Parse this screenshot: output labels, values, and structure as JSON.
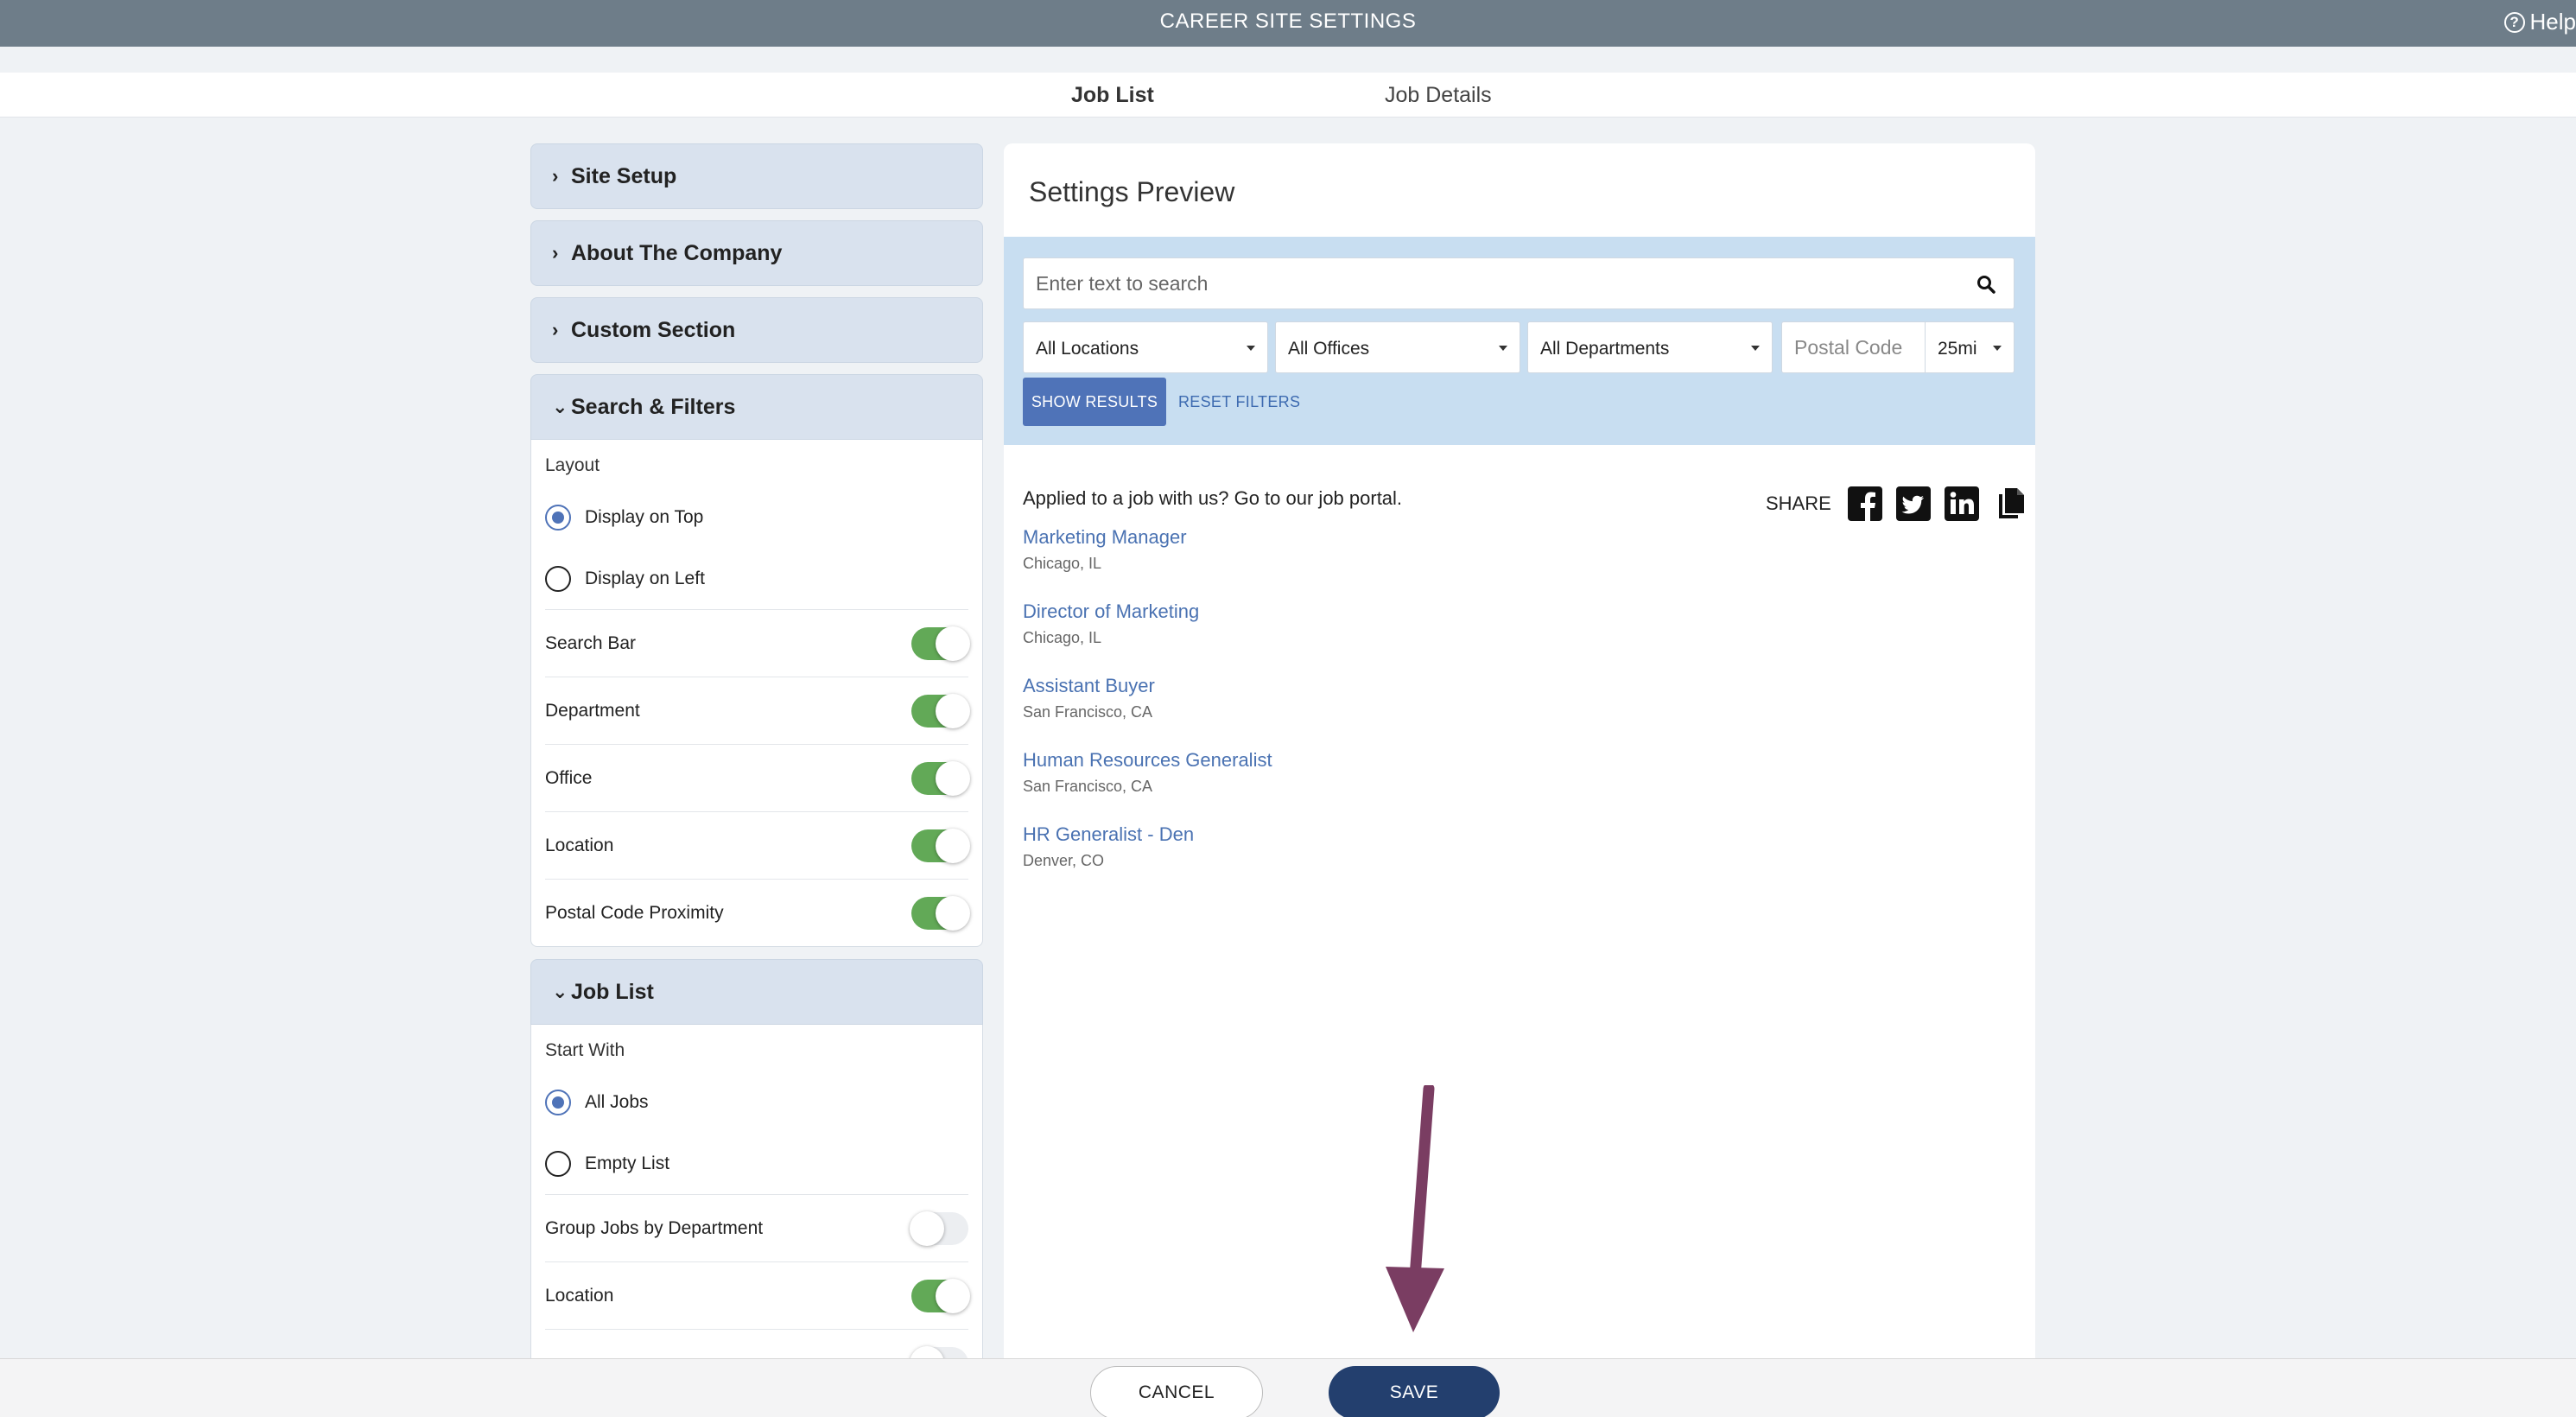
{
  "header": {
    "title": "CAREER SITE SETTINGS",
    "help_label": "Help"
  },
  "tabs": [
    {
      "label": "Job List",
      "active": true
    },
    {
      "label": "Job Details",
      "active": false
    }
  ],
  "sections": {
    "site_setup": "Site Setup",
    "about_company": "About The Company",
    "custom_section": "Custom Section",
    "search_filters": {
      "title": "Search & Filters",
      "layout_label": "Layout",
      "options": [
        "Display on Top",
        "Display on Left"
      ],
      "selected": "Display on Top",
      "toggles": [
        {
          "label": "Search Bar",
          "on": true
        },
        {
          "label": "Department",
          "on": true
        },
        {
          "label": "Office",
          "on": true
        },
        {
          "label": "Location",
          "on": true
        },
        {
          "label": "Postal Code Proximity",
          "on": true
        }
      ]
    },
    "job_list": {
      "title": "Job List",
      "start_label": "Start With",
      "options": [
        "All Jobs",
        "Empty List"
      ],
      "selected": "All Jobs",
      "toggles": [
        {
          "label": "Group Jobs by Department",
          "on": false
        },
        {
          "label": "Location",
          "on": true
        }
      ]
    }
  },
  "preview": {
    "title": "Settings Preview",
    "search_placeholder": "Enter text to search",
    "selects": [
      "All Locations",
      "All Offices",
      "All Departments"
    ],
    "postal_placeholder": "Postal Code",
    "radius": "25mi",
    "show_results": "SHOW RESULTS",
    "reset_filters": "RESET FILTERS",
    "portal_text": "Applied to a job with us? Go to our job portal.",
    "share_label": "SHARE",
    "jobs": [
      {
        "title": "Marketing Manager",
        "location": "Chicago, IL"
      },
      {
        "title": "Director of Marketing",
        "location": "Chicago, IL"
      },
      {
        "title": "Assistant Buyer",
        "location": "San Francisco, CA"
      },
      {
        "title": "Human Resources Generalist",
        "location": "San Francisco, CA"
      },
      {
        "title": "HR Generalist - Den",
        "location": "Denver, CO"
      }
    ]
  },
  "footer": {
    "cancel": "CANCEL",
    "save": "SAVE"
  },
  "colors": {
    "accent": "#4f73b8",
    "toggle_on": "#62a957",
    "save_bg": "#233f6e",
    "arrow": "#7a3d62",
    "topbar": "#6e7d89"
  }
}
